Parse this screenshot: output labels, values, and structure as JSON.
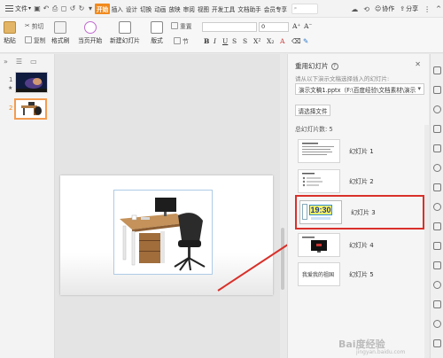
{
  "menubar": {
    "file_label": "文件",
    "tabs": [
      "开始",
      "插入",
      "设计",
      "切换",
      "动画",
      "放映",
      "审阅",
      "视图",
      "开发工具",
      "文档助手",
      "会员专享"
    ],
    "active_tab": "开始",
    "right": {
      "collab": "协作",
      "share": "分享"
    }
  },
  "ribbon": {
    "paste": "粘贴",
    "cut": "剪切",
    "copy": "复制",
    "format_painter": "格式刷",
    "from_start": "当页开始",
    "new_slide": "新建幻灯片",
    "layout": "版式",
    "section": "节",
    "reset": "重置",
    "font_size": "0"
  },
  "thumbnails": [
    {
      "number": "1",
      "selected": false
    },
    {
      "number": "2",
      "selected": true
    }
  ],
  "reuse_pane": {
    "title": "重用幻灯片",
    "hint": "请从以下演示文稿选择插入的幻灯片:",
    "file_value": "演示文稿1.pptx（F:\\百度经验\\文档素材\\演示",
    "choose_file": "请选择文件",
    "count_label": "总幻灯片数: 5",
    "slides": [
      {
        "label": "幻灯片 1",
        "highlighted": false
      },
      {
        "label": "幻灯片 2",
        "highlighted": false
      },
      {
        "label": "幻灯片 3",
        "highlighted": true,
        "thumb_text": "19:30"
      },
      {
        "label": "幻灯片 4",
        "highlighted": false
      },
      {
        "label": "幻灯片 5",
        "highlighted": false,
        "thumb_text": "我爱我的祖国"
      }
    ]
  },
  "watermark": {
    "main": "Bai度经验",
    "sub": "jingyan.baidu.com"
  },
  "colors": {
    "accent": "#f18a1d",
    "highlight_border": "#d9302a",
    "arrow": "#d9302a"
  }
}
